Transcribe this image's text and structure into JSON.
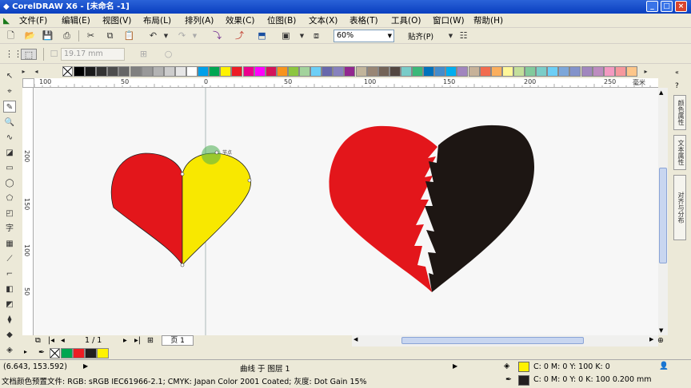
{
  "app": {
    "title": "CorelDRAW X6 - [未命名 -1]"
  },
  "menu": [
    "文件(F)",
    "编辑(E)",
    "视图(V)",
    "布局(L)",
    "排列(A)",
    "效果(C)",
    "位图(B)",
    "文本(X)",
    "表格(T)",
    "工具(O)",
    "窗口(W)",
    "帮助(H)"
  ],
  "toolbar": {
    "zoom_value": "60%",
    "snap_label": "贴齐(P)",
    "outline_width": "19.17 mm"
  },
  "palette_colors": [
    "#000000",
    "#1a1a1a",
    "#333333",
    "#4d4d4d",
    "#666666",
    "#808080",
    "#999999",
    "#b3b3b3",
    "#cccccc",
    "#e6e6e6",
    "#ffffff",
    "#00a0e9",
    "#00a651",
    "#fff200",
    "#ed1c24",
    "#ec008c",
    "#ff00ff",
    "#d4145a",
    "#f7941d",
    "#8dc63f",
    "#a3d39c",
    "#6dcff6",
    "#6868ac",
    "#8781bd",
    "#92278f",
    "#c2b59b",
    "#998675",
    "#736357",
    "#534741",
    "#7accc8",
    "#3cb878",
    "#0072bc",
    "#448ccb",
    "#00aeef",
    "#a186be",
    "#c7b299",
    "#f26c4f",
    "#fbaf5d",
    "#fff799",
    "#c4df9b",
    "#82ca9c",
    "#7bcdc8",
    "#6dcff6",
    "#7da7d9",
    "#8393ca",
    "#a187be",
    "#bd8cbf",
    "#f49ac1",
    "#f6989d",
    "#fdc68a"
  ],
  "ruler": {
    "unit": "毫米",
    "h_labels": [
      "100",
      "50",
      "0",
      "50",
      "100",
      "150",
      "200",
      "250"
    ],
    "v_labels": [
      "200",
      "150",
      "100",
      "50"
    ]
  },
  "canvas": {
    "node_label": "节点",
    "heart1_colors": [
      "#e3161b",
      "#f8e800"
    ],
    "heart2_colors": [
      "#e3161b",
      "#1d1613"
    ]
  },
  "pagebar": {
    "page_count": "1 / 1",
    "page_tab": "页 1"
  },
  "docker_tabs": [
    "颜色属性",
    "文本属性",
    "对齐与分布"
  ],
  "bottom_palette": [
    "#ffffff",
    "#00a651",
    "#ed1c24",
    "#231f20",
    "#fff200"
  ],
  "status": {
    "coords": "(6.643, 153.592)",
    "object_info": "曲线 于 图层 1",
    "fill_info": "C: 0 M: 0 Y: 100 K: 0",
    "outline_info": "C: 0 M: 0 Y: 0 K: 100  0.200 mm",
    "fill_color": "#fff200",
    "outline_color": "#231f20",
    "profile": "文档颜色预置文件: RGB: sRGB IEC61966-2.1; CMYK: Japan Color 2001 Coated; 灰度: Dot Gain 15%"
  }
}
